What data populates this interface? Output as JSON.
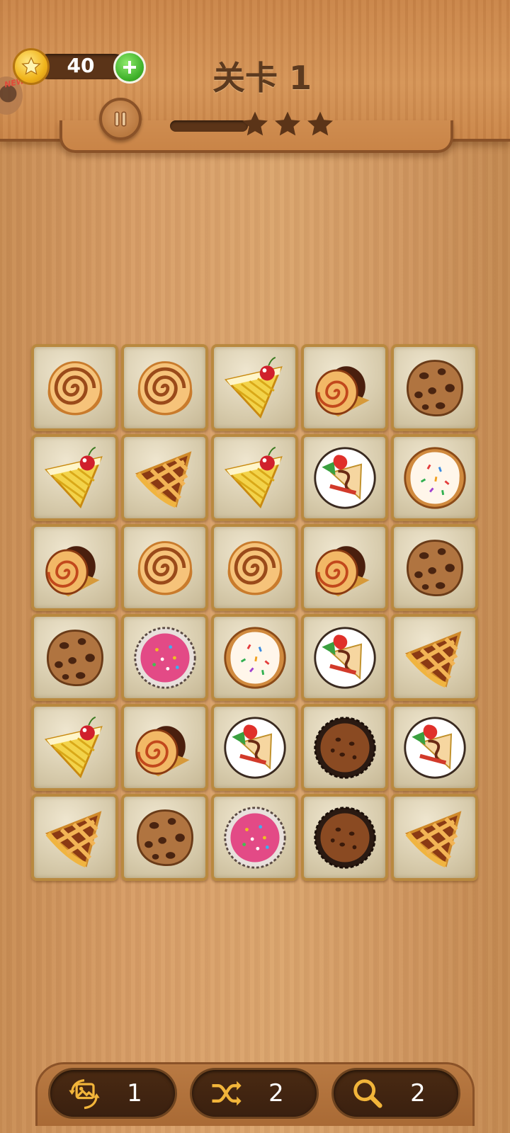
{
  "header": {
    "new_badge": "NEW!",
    "coins": "40",
    "level_title": "关卡 1",
    "progress_fraction": 0.0,
    "stars_earned": 0,
    "stars_total": 3
  },
  "board": {
    "rows": 6,
    "cols": 5,
    "tiles": [
      [
        "cinnamon-roll",
        "cinnamon-roll",
        "cheese-cake",
        "swiss-roll",
        "chocolate-chip-cookie"
      ],
      [
        "cheese-cake",
        "lattice-pie",
        "cheese-cake",
        "crepe-plate",
        "sprinkle-cookie"
      ],
      [
        "swiss-roll",
        "cinnamon-roll",
        "cinnamon-roll",
        "swiss-roll",
        "chocolate-chip-cookie"
      ],
      [
        "chocolate-chip-cookie",
        "pink-cupcake",
        "sprinkle-cookie",
        "crepe-plate",
        "lattice-pie"
      ],
      [
        "cheese-cake",
        "swiss-roll",
        "crepe-plate",
        "chocolate-muffin",
        "crepe-plate"
      ],
      [
        "lattice-pie",
        "chocolate-chip-cookie",
        "pink-cupcake",
        "chocolate-muffin",
        "lattice-pie"
      ]
    ]
  },
  "powerups": [
    {
      "icon": "swap-image-icon",
      "count": "1"
    },
    {
      "icon": "shuffle-icon",
      "count": "2"
    },
    {
      "icon": "magnifier-icon",
      "count": "2"
    }
  ],
  "colors": {
    "wood": "#d9a06a",
    "header_wood": "#d59457",
    "dark_brown": "#5c3a1f",
    "tile_border": "#b9893f"
  }
}
